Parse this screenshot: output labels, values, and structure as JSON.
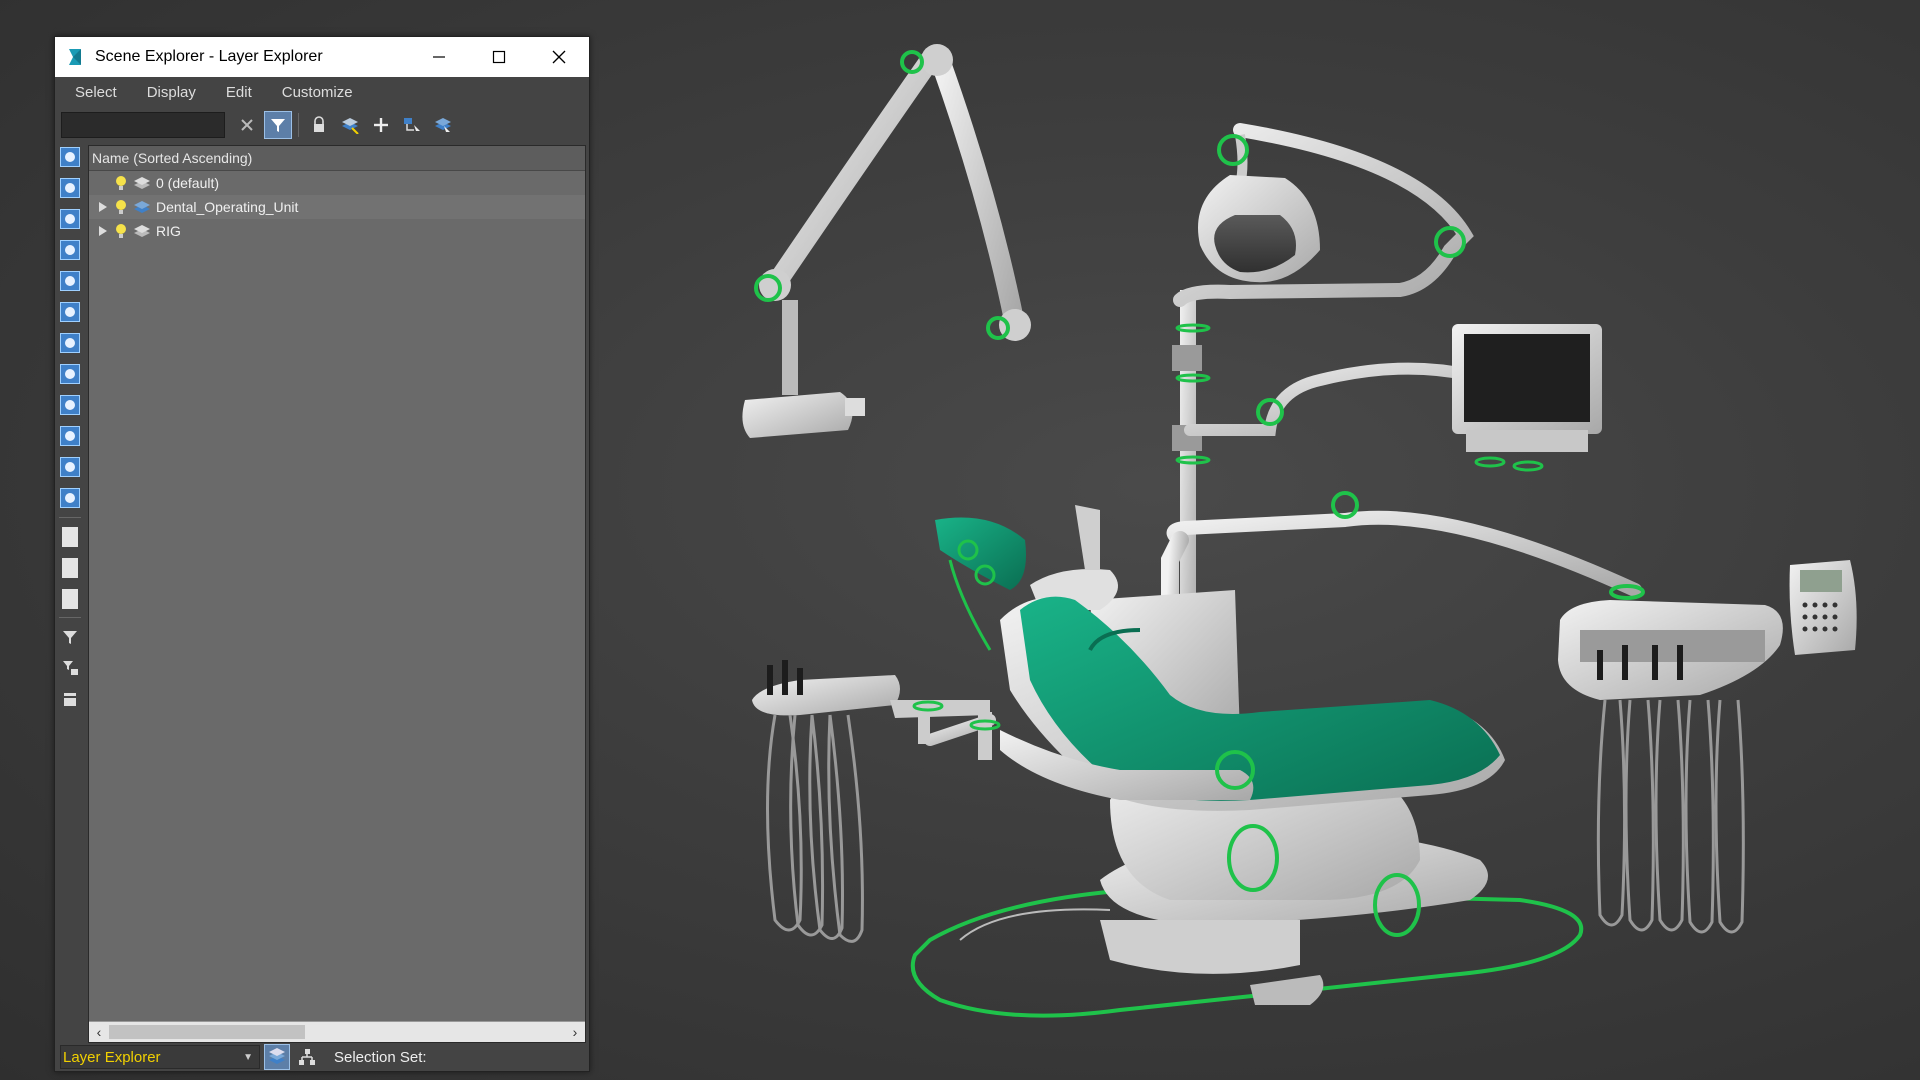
{
  "window": {
    "title": "Scene Explorer - Layer Explorer",
    "controls": [
      "minimize",
      "maximize",
      "close"
    ]
  },
  "menu": {
    "items": [
      "Select",
      "Display",
      "Edit",
      "Customize"
    ]
  },
  "toolbar": {
    "search_value": "",
    "icons": [
      "clear-filter-icon",
      "filter-toggle-icon",
      "lock-icon",
      "create-layer-icon",
      "add-selection-icon",
      "select-children-icon",
      "find-icon"
    ]
  },
  "list": {
    "column_header": "Name (Sorted Ascending)",
    "rows": [
      {
        "name": "0 (default)",
        "expandable": false,
        "highlighted": false
      },
      {
        "name": "Dental_Operating_Unit",
        "expandable": true,
        "highlighted": true
      },
      {
        "name": "RIG",
        "expandable": true,
        "highlighted": false
      }
    ]
  },
  "statusbar": {
    "explorer_mode": "Layer Explorer",
    "selection_set_label": "Selection Set:"
  },
  "colors": {
    "accent_blue": "#3f80c8",
    "mode_text": "#f1d000",
    "rig_green": "#1fc24a",
    "upholstery_teal": "#0e9a76"
  }
}
